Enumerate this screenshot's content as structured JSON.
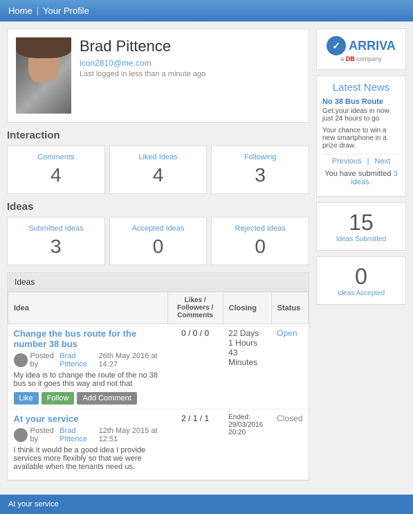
{
  "nav": {
    "home": "Home",
    "separator": "|",
    "your_profile": "Your Profile"
  },
  "profile": {
    "name": "Brad Pittence",
    "email": "icon2810@me.com",
    "last_login": "Last logged in less than a minute ago"
  },
  "interaction": {
    "label": "Interaction",
    "comments": {
      "label": "Comments",
      "value": "4"
    },
    "liked_ideas": {
      "label": "Liked Ideas",
      "value": "4"
    },
    "following": {
      "label": "Following",
      "value": "3"
    }
  },
  "ideas_section": {
    "label": "Ideas",
    "submitted": {
      "label": "Submitted Ideas",
      "value": "3"
    },
    "accepted": {
      "label": "Accepted Ideas",
      "value": "0"
    },
    "rejected": {
      "label": "Rejected Ideas",
      "value": "0"
    }
  },
  "ideas_table": {
    "header": "Ideas",
    "columns": {
      "idea": "Idea",
      "likes": "Likes / Followers / Comments",
      "closing": "Closing",
      "status": "Status"
    },
    "rows": [
      {
        "title": "Change the bus route for the number 38 bus",
        "posted_by": "Posted by",
        "author": "Brad Pittence",
        "date": "26th May 2016 at 14:27",
        "body": "My idea is to change the route of the no 38 bus so it goes this way and not that",
        "likes": "0 / 0 / 0",
        "closing_line1": "22 Days",
        "closing_line2": "1 Hours",
        "closing_line3": "43 Minutes",
        "status": "Open",
        "btn_like": "Like",
        "btn_follow": "Follow",
        "btn_comment": "Add Comment"
      },
      {
        "title": "At your service",
        "posted_by": "Posted by",
        "author": "Brad Pittence",
        "date": "12th May 2015 at 12:51",
        "body": "I think it would be a good idea I provide services more flexibly so that we were available when the tenants need us.",
        "likes": "2 / 1 / 1",
        "closing_label": "Ended:",
        "closing_date": "29/03/2016 20:20",
        "status": "Closed"
      }
    ]
  },
  "right_col": {
    "arriva": {
      "name": "ARRIVA",
      "sub": "a",
      "db": "DB",
      "company": "company"
    },
    "latest_news": {
      "title": "Latest News",
      "item1_title": "No 38 Bus Route",
      "item1_body": "Get your ideas in now just 24 hours to go",
      "item2_body": "Your chance to win a new smartphone in a prize draw.",
      "prev": "Previous",
      "separator": "|",
      "next": "Next"
    },
    "submitted_text": "You have submitted",
    "submitted_count": "3 ideas.",
    "stat1": {
      "value": "15",
      "label": "Ideas Submitted"
    },
    "stat2": {
      "value": "0",
      "label": "Ideas Accepted"
    }
  },
  "footer": {
    "text": "At your service"
  }
}
